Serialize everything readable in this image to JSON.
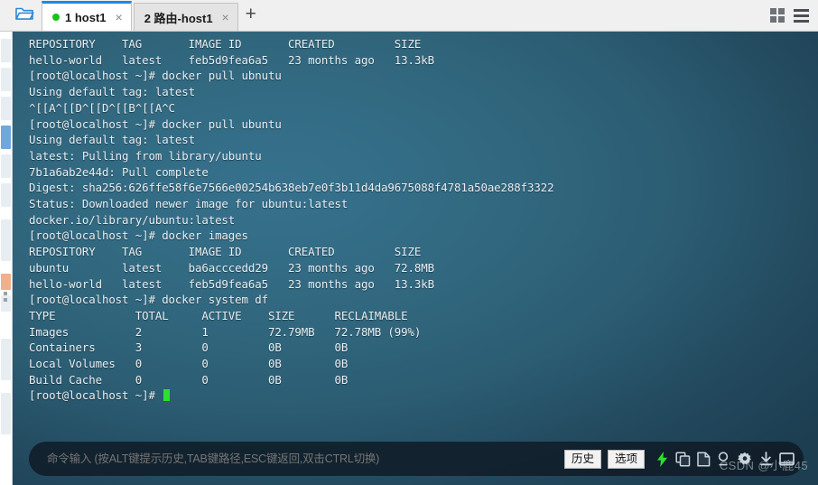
{
  "window": {
    "folder_icon": "open-folder-icon",
    "grid_icon": "grid-view-icon",
    "menu_icon": "hamburger-menu-icon",
    "add_tab_label": "+",
    "close_glyph": "×"
  },
  "tabs": [
    {
      "label": "1 host1",
      "active": true,
      "status_dot": "#16c416"
    },
    {
      "label": "2 路由-host1",
      "active": false,
      "status_dot": ""
    }
  ],
  "terminal": {
    "background_color": "#2f6580",
    "text_color": "#e9eef2",
    "cursor_color": "#2ee02e",
    "lines": [
      "REPOSITORY    TAG       IMAGE ID       CREATED         SIZE",
      "hello-world   latest    feb5d9fea6a5   23 months ago   13.3kB",
      "[root@localhost ~]# docker pull ubnutu",
      "Using default tag: latest",
      "^[[A^[[D^[[D^[[B^[[A^C",
      "[root@localhost ~]# docker pull ubuntu",
      "Using default tag: latest",
      "latest: Pulling from library/ubuntu",
      "7b1a6ab2e44d: Pull complete",
      "Digest: sha256:626ffe58f6e7566e00254b638eb7e0f3b11d4da9675088f4781a50ae288f3322",
      "Status: Downloaded newer image for ubuntu:latest",
      "docker.io/library/ubuntu:latest",
      "[root@localhost ~]# docker images",
      "REPOSITORY    TAG       IMAGE ID       CREATED         SIZE",
      "ubuntu        latest    ba6acccedd29   23 months ago   72.8MB",
      "hello-world   latest    feb5d9fea6a5   23 months ago   13.3kB",
      "[root@localhost ~]# docker system df",
      "TYPE            TOTAL     ACTIVE    SIZE      RECLAIMABLE",
      "Images          2         1         72.79MB   72.78MB (99%)",
      "Containers      3         0         0B        0B",
      "Local Volumes   0         0         0B        0B",
      "Build Cache     0         0         0B        0B"
    ],
    "prompt": "[root@localhost ~]# "
  },
  "commandbar": {
    "placeholder": "命令输入 (按ALT键提示历史,TAB键路径,ESC键返回,双击CTRL切换)",
    "value": "",
    "history_label": "历史",
    "options_label": "选项",
    "icons": [
      "lightning-bolt-icon",
      "copy-icon",
      "paste-icon",
      "search-icon",
      "gear-icon",
      "download-icon",
      "window-icon"
    ],
    "bolt_color": "#2ee02e"
  },
  "watermark": {
    "text": "CSDN @小鹿45"
  }
}
